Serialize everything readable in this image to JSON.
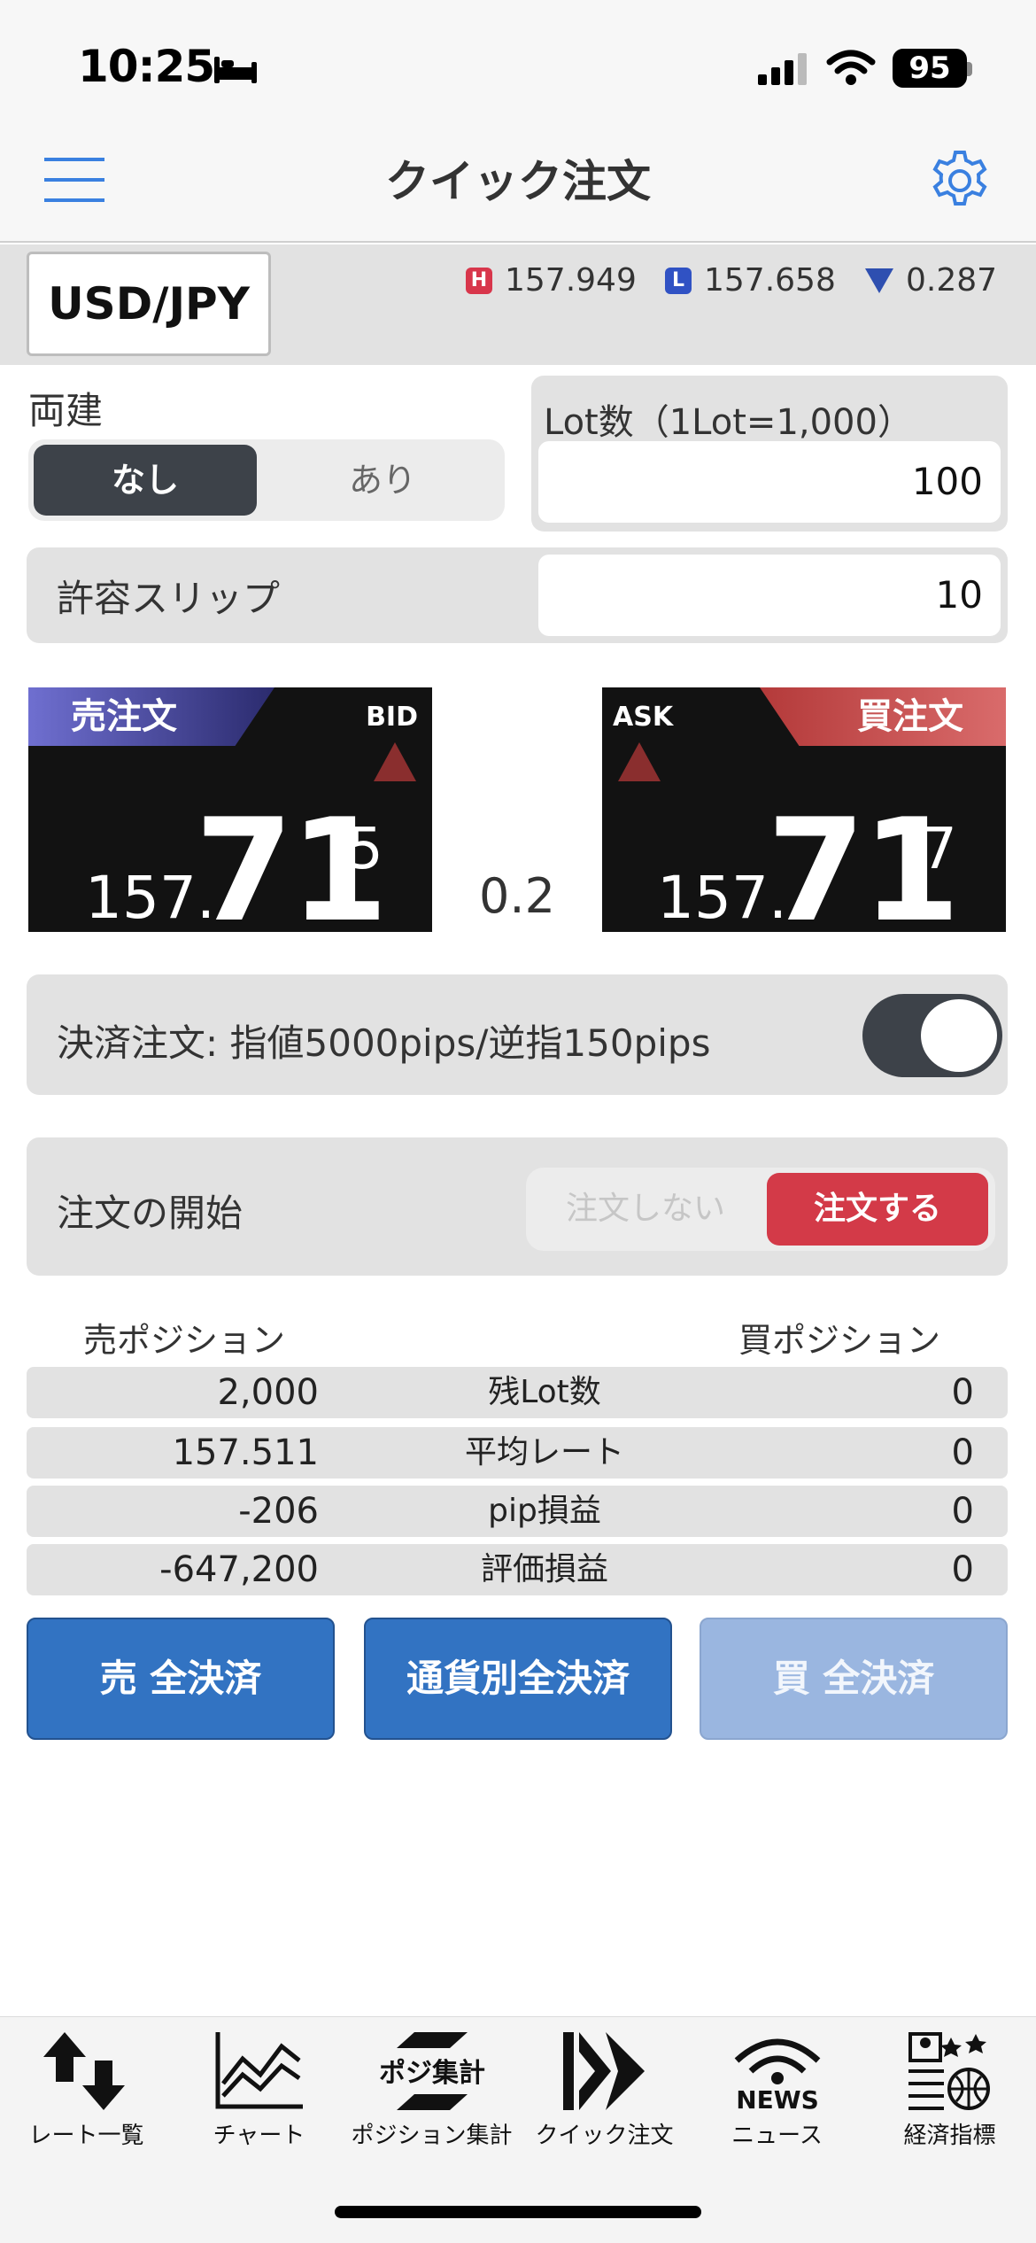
{
  "status": {
    "time": "10:25",
    "battery": "95"
  },
  "header": {
    "title": "クイック注文"
  },
  "currency": {
    "pair": "USD/JPY",
    "high_badge": "H",
    "high": "157.949",
    "low_badge": "L",
    "low": "157.658",
    "range": "0.287"
  },
  "ryodate": {
    "label": "両建",
    "options": [
      "なし",
      "あり"
    ],
    "selected": "なし"
  },
  "lot": {
    "label": "Lot数（1Lot=1,000）",
    "value": "100"
  },
  "slip": {
    "label": "許容スリップ",
    "value": "10"
  },
  "sell": {
    "tag": "売注文",
    "side_label": "BID",
    "price_prefix": "157.",
    "price_main": "71",
    "price_sup": "5"
  },
  "buy": {
    "tag": "買注文",
    "side_label": "ASK",
    "price_prefix": "157.",
    "price_main": "71",
    "price_sup": "7"
  },
  "spread": "0.2",
  "settle": {
    "label": "決済注文: 指値5000pips/逆指150pips",
    "enabled": true
  },
  "order_start": {
    "label": "注文の開始",
    "off_label": "注文しない",
    "on_label": "注文する",
    "selected": "注文する"
  },
  "positions": {
    "sell_header": "売ポジション",
    "buy_header": "買ポジション",
    "rows": [
      {
        "label": "残Lot数",
        "sell": "2,000",
        "buy": "0"
      },
      {
        "label": "平均レート",
        "sell": "157.511",
        "buy": "0"
      },
      {
        "label": "pip損益",
        "sell": "-206",
        "buy": "0"
      },
      {
        "label": "評価損益",
        "sell": "-647,200",
        "buy": "0"
      }
    ]
  },
  "close_buttons": {
    "sell_all": "売 全決済",
    "currency_all": "通貨別全決済",
    "buy_all": "買 全決済"
  },
  "tabs": [
    {
      "label": "レート一覧",
      "icon": "rate-list-icon"
    },
    {
      "label": "チャート",
      "icon": "chart-icon"
    },
    {
      "label": "ポジション集計",
      "icon": "position-summary-icon",
      "icon_text": "ポジ集計"
    },
    {
      "label": "クイック注文",
      "icon": "quick-order-icon"
    },
    {
      "label": "ニュース",
      "icon": "news-icon",
      "icon_text": "NEWS"
    },
    {
      "label": "経済指標",
      "icon": "economic-indicator-icon"
    }
  ],
  "colors": {
    "accent_blue": "#3273c2",
    "buy_red": "#d33a48",
    "toggle_dark": "#3d4249",
    "high_badge": "#d8364b",
    "low_badge": "#3052c4"
  }
}
